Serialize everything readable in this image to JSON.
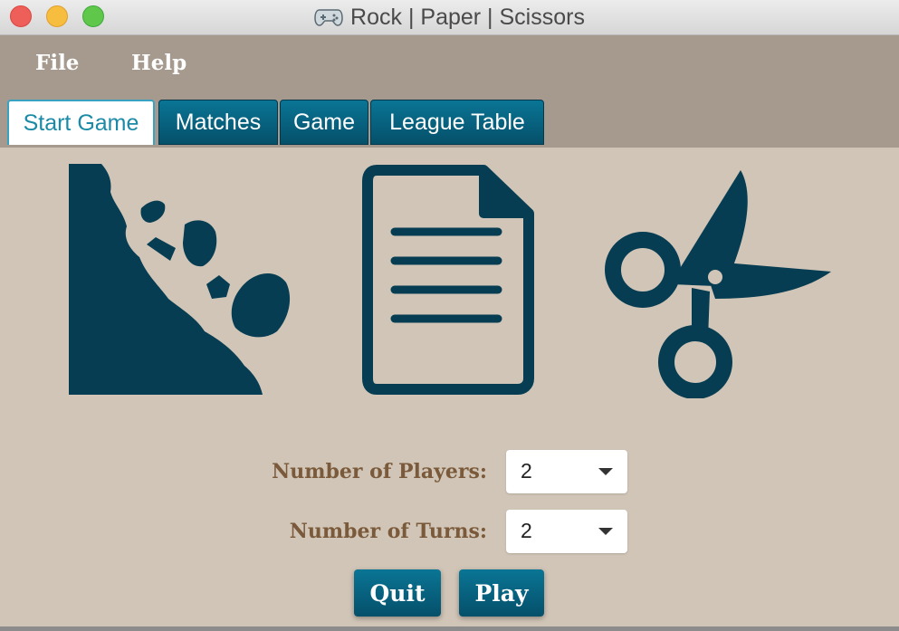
{
  "window": {
    "title": "Rock | Paper | Scissors",
    "icon": "gamepad-icon"
  },
  "menu": {
    "file": "File",
    "help": "Help"
  },
  "tabs": [
    {
      "label": "Start Game",
      "active": true
    },
    {
      "label": "Matches"
    },
    {
      "label": "Game"
    },
    {
      "label": "League Table"
    }
  ],
  "images": [
    "rock-icon",
    "paper-icon",
    "scissors-icon"
  ],
  "form": {
    "players_label": "Number of Players:",
    "players_value": "2",
    "turns_label": "Number of Turns:",
    "turns_value": "2"
  },
  "buttons": {
    "quit": "Quit",
    "play": "Play"
  },
  "colors": {
    "accent": "#05506a",
    "icon": "#063d52",
    "background": "#d1c5b7",
    "menubar": "#a69a8f",
    "label": "#7a5a3a"
  }
}
